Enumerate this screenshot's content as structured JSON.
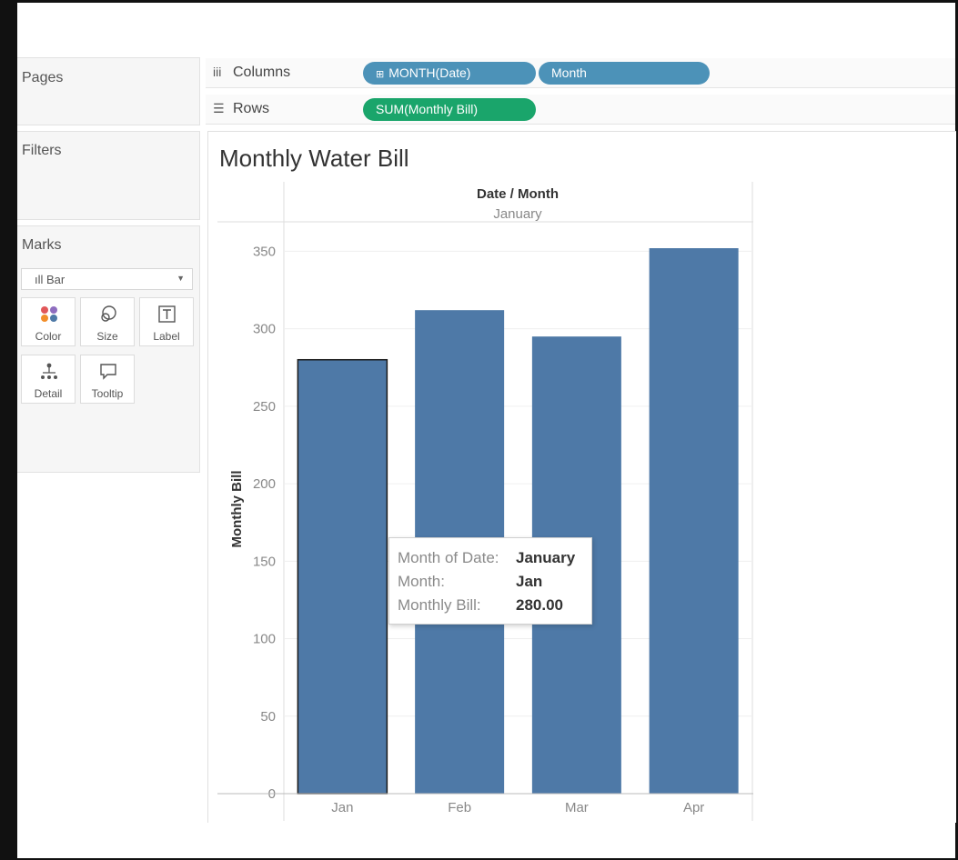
{
  "shelves": {
    "pages": "Pages",
    "filters": "Filters",
    "marks": "Marks",
    "marks_type": "Bar",
    "mark_buttons": [
      "Color",
      "Size",
      "Label",
      "Detail",
      "Tooltip"
    ]
  },
  "columns": {
    "label": "Columns",
    "pills": [
      "MONTH(Date)",
      "Month"
    ]
  },
  "rows": {
    "label": "Rows",
    "pills": [
      "SUM(Monthly Bill)"
    ]
  },
  "colors": {
    "bar": "#4e79a7",
    "pill_blue": "#4c92b8",
    "pill_green": "#1aa56b"
  },
  "tooltip": {
    "items": [
      {
        "key": "Month of Date:",
        "value": "January"
      },
      {
        "key": "Month:",
        "value": "Jan"
      },
      {
        "key": "Monthly Bill:",
        "value": "280.00"
      }
    ]
  },
  "chart_data": {
    "type": "bar",
    "title": "Monthly Water Bill",
    "header_field": "Date / Month",
    "header_value": "January",
    "ylabel": "Monthly Bill",
    "xlabel": "",
    "categories": [
      "Jan",
      "Feb",
      "Mar",
      "Apr"
    ],
    "values": [
      280,
      312,
      295,
      352
    ],
    "ylim": [
      0,
      370
    ],
    "yticks": [
      0,
      50,
      100,
      150,
      200,
      250,
      300,
      350
    ],
    "highlighted_index": 0,
    "grid": true,
    "legend": "none"
  }
}
